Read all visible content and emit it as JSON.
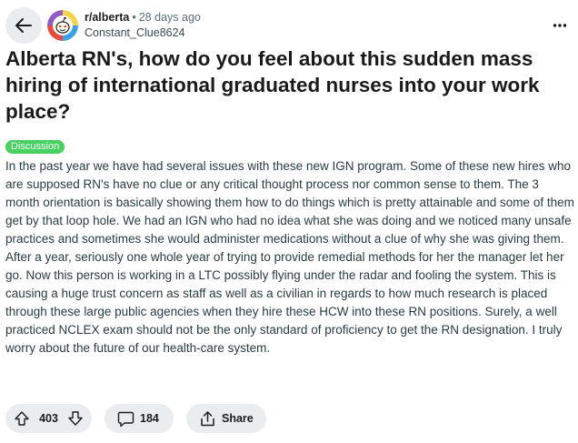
{
  "header": {
    "subreddit": "r/alberta",
    "separator": "•",
    "time_ago": "28 days ago",
    "username": "Constant_Clue8624",
    "icons": {
      "back": "arrow-left-icon",
      "more": "more-horizontal-icon",
      "avatar": "community-avatar"
    }
  },
  "post": {
    "title": "Alberta RN's, how do you feel about this sudden mass hiring of international graduated nurses into your work place?",
    "flair": "Discussion",
    "flair_color": "#46d160",
    "body": "In the past year we have had several issues with these new IGN program. Some of these new hires who are supposed RN's have no clue or any critical thought process nor common sense to them. The 3 month orientation is basically showing them how to do things which is pretty attainable and some of them get by that loop hole. We had an IGN who had no idea what she was doing and we noticed many unsafe practices and sometimes she would administer medications without a clue of why she was giving them. After a year, seriously one whole year of trying to provide remedial methods for her the manager let her go. Now this person is working in a LTC possibly flying under the radar and fooling the system. This is causing a huge trust concern as staff as well as a civilian in regards to how much research is placed through these large public agencies when they hire these HCW into these RN positions. Surely, a well practiced NCLEX exam should not be the only standard of proficiency to get the RN designation. I truly worry about the future of our health-care system."
  },
  "actions": {
    "vote_count": "403",
    "comment_count": "184",
    "share_label": "Share",
    "icons": {
      "upvote": "upvote-arrow-icon",
      "downvote": "downvote-arrow-icon",
      "comment": "comment-bubble-icon",
      "share": "share-icon"
    }
  },
  "colors": {
    "pill_background": "#eaedef",
    "flair": "#46d160"
  }
}
